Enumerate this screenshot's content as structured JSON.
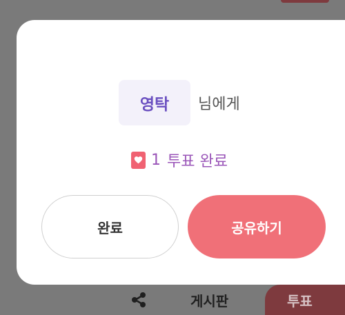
{
  "dialog": {
    "recipient_name": "영탁",
    "recipient_suffix": "님에게",
    "vote_count": "1",
    "vote_text": "투표 완료",
    "done_label": "완료",
    "share_label": "공유하기"
  },
  "bottom_bar": {
    "share_icon": "share-icon",
    "board_label": "게시판",
    "vote_label": "투표"
  },
  "colors": {
    "overlay": "#7a7a7a",
    "name_accent": "#6a4fc0",
    "vote_text": "#9a55b8",
    "heart": "#f06272",
    "share_button": "#f07078",
    "vote_tab": "#7e3a3e"
  }
}
